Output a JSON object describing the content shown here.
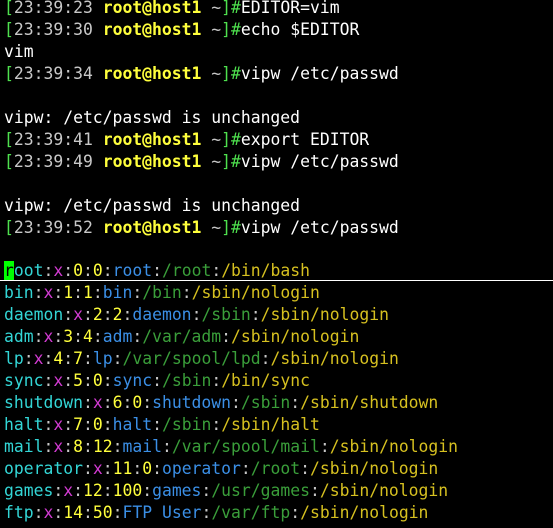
{
  "prompt": {
    "open": "[",
    "user": "root@host1",
    "path": "~",
    "close": "]#"
  },
  "shell_lines": [
    {
      "time": "23:39:23",
      "command": "EDITOR=vim"
    },
    {
      "time": "23:39:30",
      "command": "echo $EDITOR"
    },
    {
      "output": "vim"
    },
    {
      "time": "23:39:34",
      "command": "vipw /etc/passwd"
    },
    {
      "output": ""
    },
    {
      "output": "vipw: /etc/passwd is unchanged"
    },
    {
      "time": "23:39:41",
      "command": "export EDITOR"
    },
    {
      "time": "23:39:49",
      "command": "vipw /etc/passwd"
    },
    {
      "output": ""
    },
    {
      "output": "vipw: /etc/passwd is unchanged"
    },
    {
      "time": "23:39:52",
      "command": "vipw /etc/passwd"
    }
  ],
  "vim": {
    "cursor_char": "r",
    "entries": [
      {
        "name": "root",
        "pw": "x",
        "uid": "0",
        "gid": "0",
        "gecos": "root",
        "home": "/root",
        "shell": "/bin/bash"
      },
      {
        "name": "bin",
        "pw": "x",
        "uid": "1",
        "gid": "1",
        "gecos": "bin",
        "home": "/bin",
        "shell": "/sbin/nologin"
      },
      {
        "name": "daemon",
        "pw": "x",
        "uid": "2",
        "gid": "2",
        "gecos": "daemon",
        "home": "/sbin",
        "shell": "/sbin/nologin"
      },
      {
        "name": "adm",
        "pw": "x",
        "uid": "3",
        "gid": "4",
        "gecos": "adm",
        "home": "/var/adm",
        "shell": "/sbin/nologin"
      },
      {
        "name": "lp",
        "pw": "x",
        "uid": "4",
        "gid": "7",
        "gecos": "lp",
        "home": "/var/spool/lpd",
        "shell": "/sbin/nologin"
      },
      {
        "name": "sync",
        "pw": "x",
        "uid": "5",
        "gid": "0",
        "gecos": "sync",
        "home": "/sbin",
        "shell": "/bin/sync"
      },
      {
        "name": "shutdown",
        "pw": "x",
        "uid": "6",
        "gid": "0",
        "gecos": "shutdown",
        "home": "/sbin",
        "shell": "/sbin/shutdown"
      },
      {
        "name": "halt",
        "pw": "x",
        "uid": "7",
        "gid": "0",
        "gecos": "halt",
        "home": "/sbin",
        "shell": "/sbin/halt"
      },
      {
        "name": "mail",
        "pw": "x",
        "uid": "8",
        "gid": "12",
        "gecos": "mail",
        "home": "/var/spool/mail",
        "shell": "/sbin/nologin"
      },
      {
        "name": "operator",
        "pw": "x",
        "uid": "11",
        "gid": "0",
        "gecos": "operator",
        "home": "/root",
        "shell": "/sbin/nologin"
      },
      {
        "name": "games",
        "pw": "x",
        "uid": "12",
        "gid": "100",
        "gecos": "games",
        "home": "/usr/games",
        "shell": "/sbin/nologin"
      },
      {
        "name": "ftp",
        "pw": "x",
        "uid": "14",
        "gid": "50",
        "gecos": "FTP User",
        "home": "/var/ftp",
        "shell": "/sbin/nologin"
      }
    ]
  }
}
